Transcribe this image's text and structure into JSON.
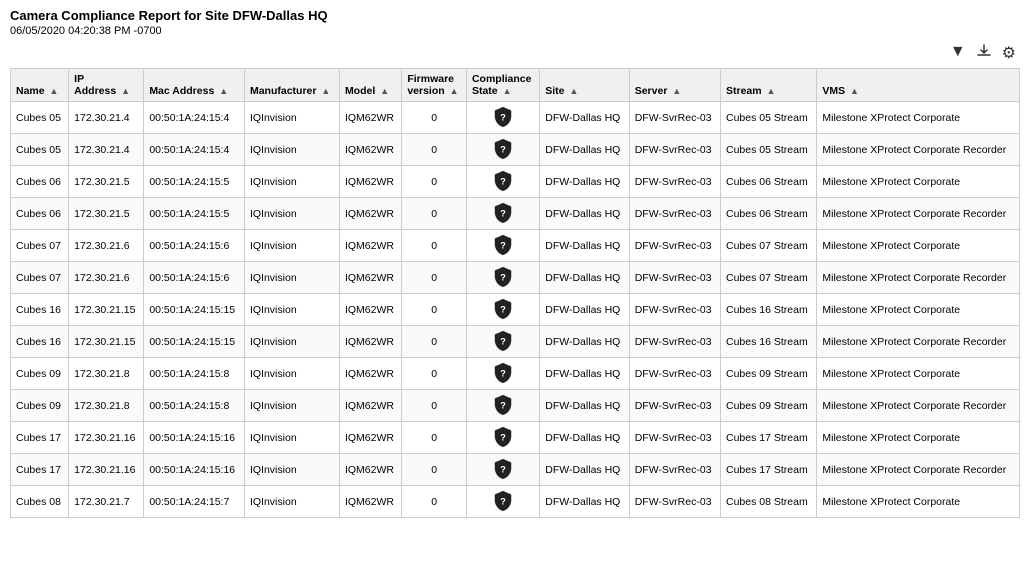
{
  "header": {
    "title": "Camera Compliance Report for Site DFW-Dallas HQ",
    "date": "06/05/2020 04:20:38 PM -0700"
  },
  "toolbar": {
    "filter_label": "▼",
    "download_label": "⬇",
    "settings_label": "⚙"
  },
  "columns": [
    {
      "key": "name",
      "label": "Name"
    },
    {
      "key": "ip",
      "label": "IP Address"
    },
    {
      "key": "mac",
      "label": "Mac Address"
    },
    {
      "key": "manufacturer",
      "label": "Manufacturer"
    },
    {
      "key": "model",
      "label": "Model"
    },
    {
      "key": "firmware",
      "label": "Firmware version"
    },
    {
      "key": "compliance",
      "label": "Compliance State"
    },
    {
      "key": "site",
      "label": "Site"
    },
    {
      "key": "server",
      "label": "Server"
    },
    {
      "key": "stream",
      "label": "Stream"
    },
    {
      "key": "vms",
      "label": "VMS"
    }
  ],
  "rows": [
    {
      "name": "Cubes 05",
      "ip": "172.30.21.4",
      "mac": "00:50:1A:24:15:4",
      "manufacturer": "IQInvision",
      "model": "IQM62WR",
      "firmware": "0",
      "compliance": "unknown",
      "site": "DFW-Dallas HQ",
      "server": "DFW-SvrRec-03",
      "stream": "Cubes 05 Stream",
      "vms": "Milestone XProtect Corporate"
    },
    {
      "name": "Cubes 05",
      "ip": "172.30.21.4",
      "mac": "00:50:1A:24:15:4",
      "manufacturer": "IQInvision",
      "model": "IQM62WR",
      "firmware": "0",
      "compliance": "unknown",
      "site": "DFW-Dallas HQ",
      "server": "DFW-SvrRec-03",
      "stream": "Cubes 05 Stream",
      "vms": "Milestone XProtect Corporate Recorder"
    },
    {
      "name": "Cubes 06",
      "ip": "172.30.21.5",
      "mac": "00:50:1A:24:15:5",
      "manufacturer": "IQInvision",
      "model": "IQM62WR",
      "firmware": "0",
      "compliance": "unknown",
      "site": "DFW-Dallas HQ",
      "server": "DFW-SvrRec-03",
      "stream": "Cubes 06 Stream",
      "vms": "Milestone XProtect Corporate"
    },
    {
      "name": "Cubes 06",
      "ip": "172.30.21.5",
      "mac": "00:50:1A:24:15:5",
      "manufacturer": "IQInvision",
      "model": "IQM62WR",
      "firmware": "0",
      "compliance": "unknown",
      "site": "DFW-Dallas HQ",
      "server": "DFW-SvrRec-03",
      "stream": "Cubes 06 Stream",
      "vms": "Milestone XProtect Corporate Recorder"
    },
    {
      "name": "Cubes 07",
      "ip": "172.30.21.6",
      "mac": "00:50:1A:24:15:6",
      "manufacturer": "IQInvision",
      "model": "IQM62WR",
      "firmware": "0",
      "compliance": "unknown",
      "site": "DFW-Dallas HQ",
      "server": "DFW-SvrRec-03",
      "stream": "Cubes 07 Stream",
      "vms": "Milestone XProtect Corporate"
    },
    {
      "name": "Cubes 07",
      "ip": "172.30.21.6",
      "mac": "00:50:1A:24:15:6",
      "manufacturer": "IQInvision",
      "model": "IQM62WR",
      "firmware": "0",
      "compliance": "unknown",
      "site": "DFW-Dallas HQ",
      "server": "DFW-SvrRec-03",
      "stream": "Cubes 07 Stream",
      "vms": "Milestone XProtect Corporate Recorder"
    },
    {
      "name": "Cubes 16",
      "ip": "172.30.21.15",
      "mac": "00:50:1A:24:15:15",
      "manufacturer": "IQInvision",
      "model": "IQM62WR",
      "firmware": "0",
      "compliance": "unknown",
      "site": "DFW-Dallas HQ",
      "server": "DFW-SvrRec-03",
      "stream": "Cubes 16 Stream",
      "vms": "Milestone XProtect Corporate"
    },
    {
      "name": "Cubes 16",
      "ip": "172.30.21.15",
      "mac": "00:50:1A:24:15:15",
      "manufacturer": "IQInvision",
      "model": "IQM62WR",
      "firmware": "0",
      "compliance": "unknown",
      "site": "DFW-Dallas HQ",
      "server": "DFW-SvrRec-03",
      "stream": "Cubes 16 Stream",
      "vms": "Milestone XProtect Corporate Recorder"
    },
    {
      "name": "Cubes 09",
      "ip": "172.30.21.8",
      "mac": "00:50:1A:24:15:8",
      "manufacturer": "IQInvision",
      "model": "IQM62WR",
      "firmware": "0",
      "compliance": "unknown",
      "site": "DFW-Dallas HQ",
      "server": "DFW-SvrRec-03",
      "stream": "Cubes 09 Stream",
      "vms": "Milestone XProtect Corporate"
    },
    {
      "name": "Cubes 09",
      "ip": "172.30.21.8",
      "mac": "00:50:1A:24:15:8",
      "manufacturer": "IQInvision",
      "model": "IQM62WR",
      "firmware": "0",
      "compliance": "unknown",
      "site": "DFW-Dallas HQ",
      "server": "DFW-SvrRec-03",
      "stream": "Cubes 09 Stream",
      "vms": "Milestone XProtect Corporate Recorder"
    },
    {
      "name": "Cubes 17",
      "ip": "172.30.21.16",
      "mac": "00:50:1A:24:15:16",
      "manufacturer": "IQInvision",
      "model": "IQM62WR",
      "firmware": "0",
      "compliance": "unknown",
      "site": "DFW-Dallas HQ",
      "server": "DFW-SvrRec-03",
      "stream": "Cubes 17 Stream",
      "vms": "Milestone XProtect Corporate"
    },
    {
      "name": "Cubes 17",
      "ip": "172.30.21.16",
      "mac": "00:50:1A:24:15:16",
      "manufacturer": "IQInvision",
      "model": "IQM62WR",
      "firmware": "0",
      "compliance": "unknown",
      "site": "DFW-Dallas HQ",
      "server": "DFW-SvrRec-03",
      "stream": "Cubes 17 Stream",
      "vms": "Milestone XProtect Corporate Recorder"
    },
    {
      "name": "Cubes 08",
      "ip": "172.30.21.7",
      "mac": "00:50:1A:24:15:7",
      "manufacturer": "IQInvision",
      "model": "IQM62WR",
      "firmware": "0",
      "compliance": "unknown",
      "site": "DFW-Dallas HQ",
      "server": "DFW-SvrRec-03",
      "stream": "Cubes 08 Stream",
      "vms": "Milestone XProtect Corporate"
    }
  ]
}
